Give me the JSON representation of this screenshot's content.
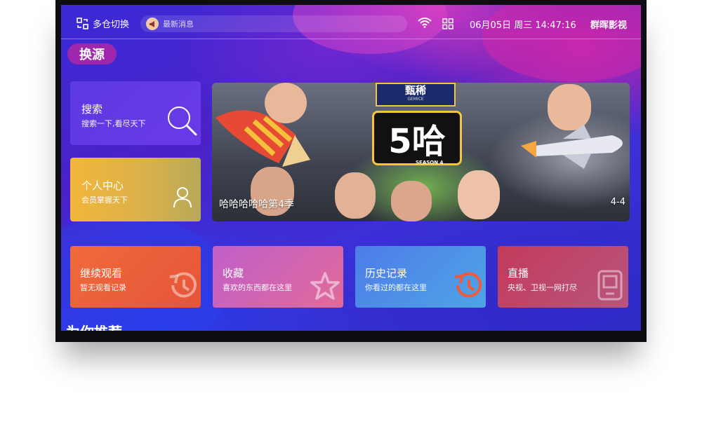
{
  "topbar": {
    "switch_label": "多仓切换",
    "news_label": "最新消息",
    "datetime": "06月05日 周三 14:47:16",
    "brand": "群晖影视"
  },
  "source_tag": "换源",
  "search_card": {
    "title": "搜索",
    "subtitle": "搜索一下,看尽天下",
    "icon": "search-icon"
  },
  "user_card": {
    "title": "个人中心",
    "subtitle": "会员掌握天下",
    "icon": "user-icon"
  },
  "banner": {
    "caption": "哈哈哈哈哈第4季",
    "logo_text": "5哈",
    "logo_sub": "SEASON 4",
    "brand_tag": "甄稀",
    "brand_tag_sub": "GEMICE",
    "counter": "4-4"
  },
  "func_cards": [
    {
      "title": "继续观看",
      "subtitle": "暂无观看记录",
      "icon": "history-icon",
      "color": "#e8663f"
    },
    {
      "title": "收藏",
      "subtitle": "喜欢的东西都在这里",
      "icon": "star-icon",
      "color": "#d85a9a"
    },
    {
      "title": "历史记录",
      "subtitle": "你看过的都在这里",
      "icon": "history-icon",
      "color": "#4a8ce0"
    },
    {
      "title": "直播",
      "subtitle": "央视、卫视一网打尽",
      "icon": "tv-icon",
      "color": "#c8456a"
    }
  ],
  "section_title": "为你推荐"
}
